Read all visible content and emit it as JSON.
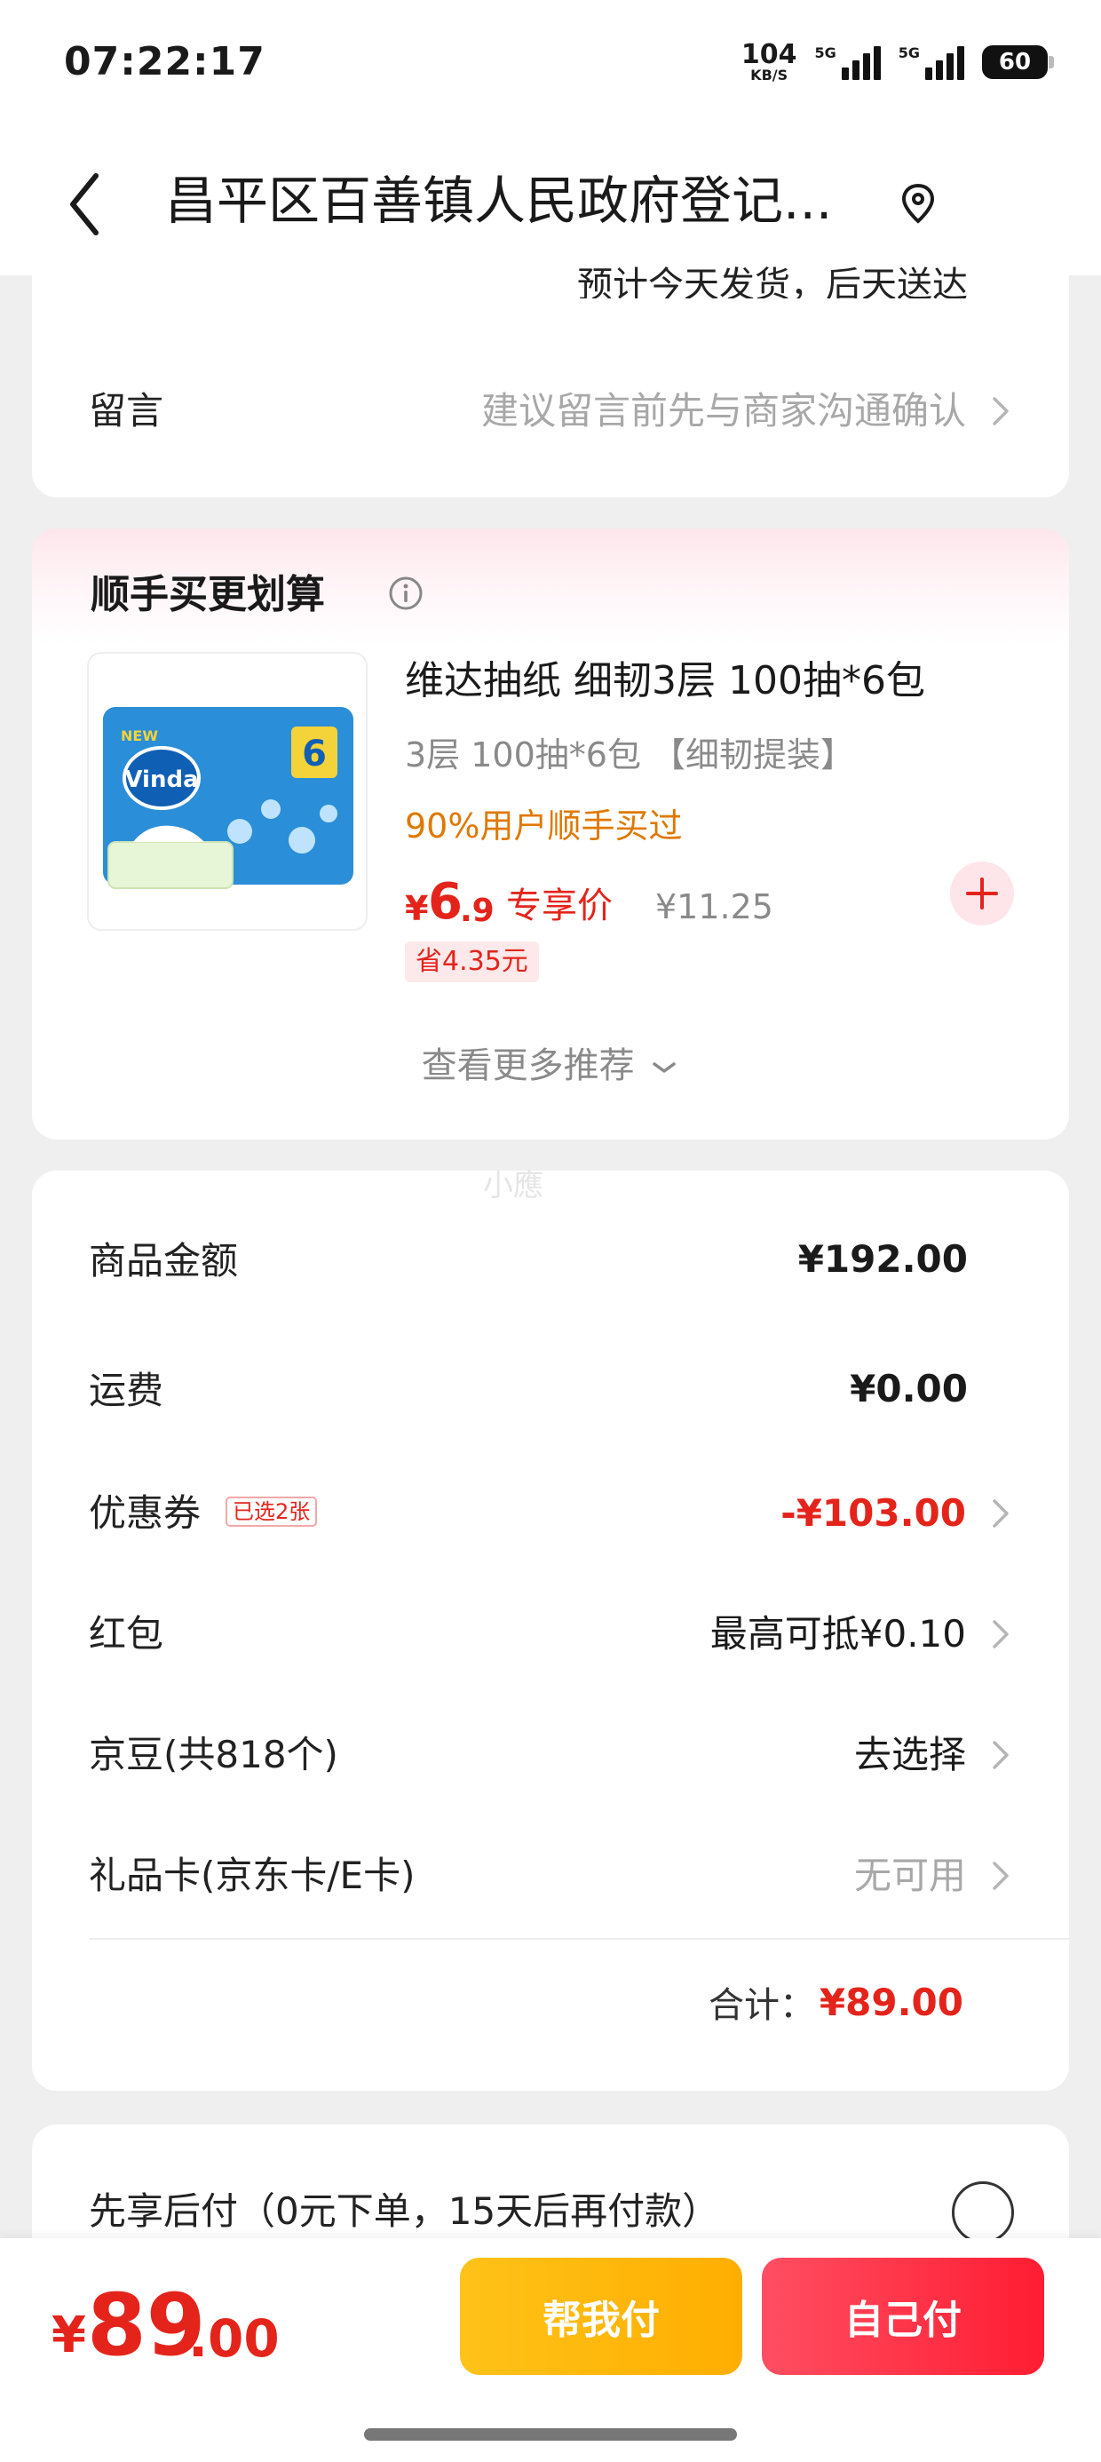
{
  "status_bar": {
    "time": "07:22:17",
    "net_speed_value": "104",
    "net_speed_unit": "KB/S",
    "signal_1_label": "5G",
    "signal_2_label": "5G",
    "battery": "60"
  },
  "header": {
    "title": "昌平区百善镇人民政府登记..."
  },
  "shipping": {
    "text": "预计今天发货，后天送达"
  },
  "message": {
    "label": "留言",
    "placeholder": "建议留言前先与商家沟通确认"
  },
  "upsell": {
    "title": "顺手买更划算",
    "product": {
      "name": "维达抽纸 细韧3层 100抽*6包",
      "spec": "3层 100抽*6包 【细韧提装】",
      "social_proof": "90%用户顺手买过",
      "price_symbol": "¥",
      "price_int": "6",
      "price_dec": ".9",
      "price_tag": "专享价",
      "original_price": "¥11.25",
      "save": "省4.35元",
      "image_brand": "Vinda",
      "image_badge": "6",
      "image_new": "NEW"
    },
    "more": "查看更多推荐"
  },
  "watermark": "小應",
  "summary": {
    "goods_amount_label": "商品金额",
    "goods_amount_value": "¥192.00",
    "shipping_label": "运费",
    "shipping_value": "¥0.00",
    "coupon_label": "优惠券",
    "coupon_badge": "已选2张",
    "coupon_value": "-¥103.00",
    "red_packet_label": "红包",
    "red_packet_value": "最高可抵¥0.10",
    "jd_beans_label": "京豆(共818个)",
    "jd_beans_value": "去选择",
    "gift_card_label": "礼品卡(京东卡/E卡)",
    "gift_card_value": "无可用",
    "total_label": "合计：",
    "total_value": "¥89.00"
  },
  "pay_later": {
    "label": "先享后付（0元下单，15天后再付款）"
  },
  "bottom": {
    "total_symbol": "¥",
    "total_int": "89",
    "total_dec": ".00",
    "help_pay_label": "帮我付",
    "self_pay_label": "自己付"
  },
  "colors": {
    "accent_red": "#e4241b",
    "orange": "#e07800",
    "help_pay_yellow": "#ffb800",
    "self_pay_red": "#ff2a3d"
  },
  "icons": [
    "back-arrow-icon",
    "location-pin-icon",
    "info-icon",
    "plus-icon",
    "chevron-right-icon",
    "chevron-down-icon"
  ]
}
